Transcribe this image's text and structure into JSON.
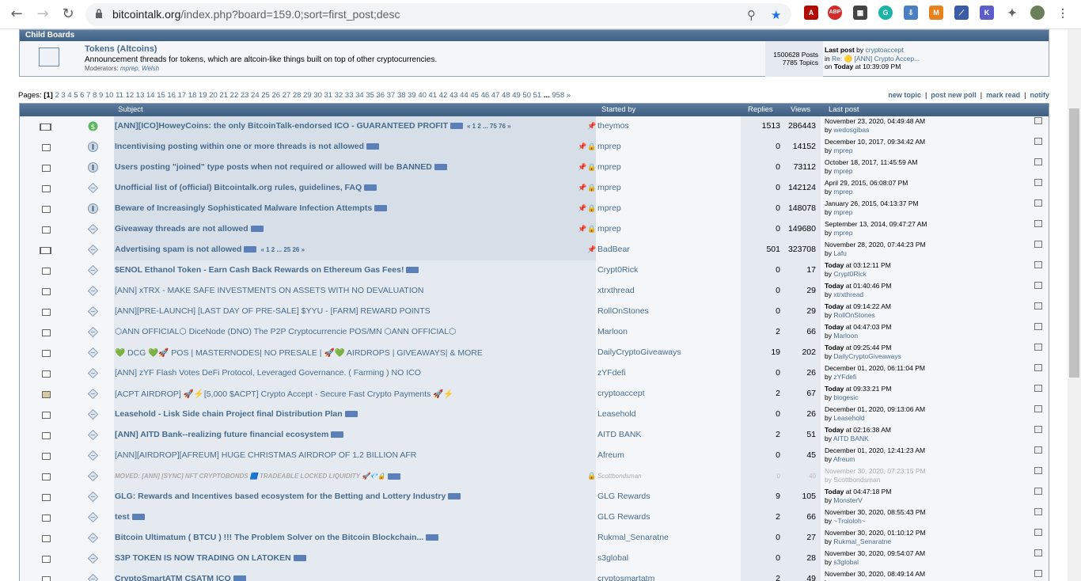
{
  "browser": {
    "url_host": "bitcointalk.org",
    "url_path": "/index.php?board=159.0;sort=first_post;desc"
  },
  "child_boards": {
    "header": "Child Boards",
    "board": {
      "name": "Tokens (Altcoins)",
      "description": "Announcement threads for tokens, which are altcoin-like things built on top of other cryptocurrencies.",
      "moderators_label": "Moderators:",
      "moderators": "mprep, Welsh",
      "posts": "1500628 Posts",
      "topics": "7785 Topics",
      "last_post_label": "Last post",
      "last_post_by": "by",
      "last_post_user": "cryptoaccept",
      "in_label": "in",
      "in_topic": "Re: 🟡 [ANN] Crypto Accep...",
      "on_label": "on",
      "on_today": "Today",
      "on_time": "at 10:39:09 PM"
    }
  },
  "pagination": {
    "label": "Pages:",
    "current": "[1]",
    "pages": "2 3 4 5 6 7 8 9 10 11 12 13 14 15 16 17 18 19 20 21 22 23 24 25 26 27 28 29 30 31 32 33 34 35 36 37 38 39 40 41 42 43 44 45 46 47 48 49 50 51",
    "ellipsis": "...",
    "last": "958",
    "next": "»"
  },
  "actions": [
    "new topic",
    "post new poll",
    "mark read",
    "notify"
  ],
  "table_headers": {
    "subject": "Subject",
    "started_by": "Started by",
    "replies": "Replies",
    "views": "Views",
    "last_post": "Last post"
  },
  "topics": [
    {
      "subject": "[ANN][ICO]HoweyCoins: the only BitcoinTalk-endorsed ICO - GUARANTEED PROFIT",
      "pages": "« 1 2 ... 75 76 »",
      "starter": "theymos",
      "replies": "1513",
      "views": "286443",
      "last_date": "November 23, 2020, 04:49:48 AM",
      "last_by": "by",
      "last_user": "wedosgibas"
    },
    {
      "subject": "Incentivising posting within one or more threads is not allowed",
      "pages": "",
      "starter": "mprep",
      "replies": "0",
      "views": "14152",
      "last_date": "December 10, 2017, 09:34:42 AM",
      "last_by": "by",
      "last_user": "mprep"
    },
    {
      "subject": "Users posting \"joined\" type posts when not required or allowed will be BANNED",
      "pages": "",
      "starter": "mprep",
      "replies": "0",
      "views": "73112",
      "last_date": "October 18, 2017, 11:45:59 AM",
      "last_by": "by",
      "last_user": "mprep"
    },
    {
      "subject": "Unofficial list of (official) Bitcointalk.org rules, guidelines, FAQ",
      "pages": "",
      "starter": "mprep",
      "replies": "0",
      "views": "142124",
      "last_date": "April 29, 2015, 06:08:07 PM",
      "last_by": "by",
      "last_user": "mprep"
    },
    {
      "subject": "Beware of Increasingly Sophisticated Malware Infection Attempts",
      "pages": "",
      "starter": "mprep",
      "replies": "0",
      "views": "148078",
      "last_date": "January 26, 2015, 04:13:37 PM",
      "last_by": "by",
      "last_user": "mprep"
    },
    {
      "subject": "Giveaway threads are not allowed",
      "pages": "",
      "starter": "mprep",
      "replies": "0",
      "views": "149680",
      "last_date": "September 13, 2014, 09:47:27 AM",
      "last_by": "by",
      "last_user": "mprep"
    },
    {
      "subject": "Advertising spam is not allowed",
      "pages": "« 1 2 ... 25 26 »",
      "starter": "BadBear",
      "replies": "501",
      "views": "323708",
      "last_date": "November 28, 2020, 07:44:23 PM",
      "last_by": "by",
      "last_user": "Lafu"
    },
    {
      "subject": "$ENOL Ethanol Token - Earn Cash Back Rewards on Ethereum Gas Fees!",
      "pages": "",
      "starter": "Crypt0Rick",
      "replies": "0",
      "views": "17",
      "last_date": "at 03:12:11 PM",
      "last_today": "Today",
      "last_by": "by",
      "last_user": "Crypt0Rick"
    },
    {
      "subject": "[ANN] xTRX - MAKE SAFE INVESTMENTS ON ASSETS WITH NO DEVALUATION",
      "pages": "",
      "starter": "xtrxthread",
      "replies": "0",
      "views": "29",
      "last_date": "at 01:40:46 PM",
      "last_today": "Today",
      "last_by": "by",
      "last_user": "xtrxthread"
    },
    {
      "subject": "[ANN][PRE-LAUNCH] [LAST DAY OF PRE-SALE] $YYU - [FARM] REWARD POINTS",
      "pages": "",
      "starter": "RollOnStones",
      "replies": "0",
      "views": "29",
      "last_date": "at 09:14:22 AM",
      "last_today": "Today",
      "last_by": "by",
      "last_user": "RollOnStones"
    },
    {
      "subject": "⬡ANN OFFICIAL⬡ DiceNode (DNO) The P2P Cryptocurrencie POS/MN ⬡ANN OFFICIAL⬡",
      "pages": "",
      "starter": "Marloon",
      "replies": "2",
      "views": "66",
      "last_date": "at 04:47:03 PM",
      "last_today": "Today",
      "last_by": "by",
      "last_user": "Marloon"
    },
    {
      "subject": "💚 DCG 💚🚀 POS | MASTERNODES| NO PRESALE | 🚀💚 AIRDROPS | GIVEAWAYS| & MORE",
      "pages": "",
      "starter": "DailyCryptoGiveaways",
      "replies": "19",
      "views": "202",
      "last_date": "at 09:25:44 PM",
      "last_today": "Today",
      "last_by": "by",
      "last_user": "DailyCryptoGiveaways"
    },
    {
      "subject": "[ANN] zYF Flash Votes DeFi Protocol, Leveraged Governance. ( Farming ) NO ICO",
      "pages": "",
      "starter": "zYFdefi",
      "replies": "0",
      "views": "26",
      "last_date": "December 01, 2020, 06:11:04 PM",
      "last_by": "by",
      "last_user": "zYFdefi"
    },
    {
      "subject": "[ACPT AIRDROP] 🚀⚡[5,000 $ACPT] Crypto Accept - Secure Fast Crypto Payments 🚀⚡",
      "pages": "",
      "starter": "cryptoaccept",
      "replies": "2",
      "views": "67",
      "last_date": "at 09:33:21 PM",
      "last_today": "Today",
      "last_by": "by",
      "last_user": "biogesic"
    },
    {
      "subject": "Leasehold - Lisk Side chain Project final Distribution Plan",
      "pages": "",
      "starter": "Leasehold",
      "replies": "0",
      "views": "26",
      "last_date": "December 01, 2020, 09:13:06 AM",
      "last_by": "by",
      "last_user": "Leasehold"
    },
    {
      "subject": "[ANN] AITD Bank--realizing future financial ecosystem",
      "pages": "",
      "starter": "AITD BANK",
      "replies": "2",
      "views": "51",
      "last_date": "at 02:16:38 AM",
      "last_today": "Today",
      "last_by": "by",
      "last_user": "AITD BANK"
    },
    {
      "subject": "[ANN][AIRDROP][AFREUM] HUGE CHRISTMAS AIRDROP OF 1.2 BILLION AFR",
      "pages": "",
      "starter": "Afreum",
      "replies": "0",
      "views": "45",
      "last_date": "December 01, 2020, 12:41:23 AM",
      "last_by": "by",
      "last_user": "Afreum"
    },
    {
      "subject": "MOVED: [ANN] [SYNC] NFT CRYPTOBONDS 🟦 TRADEABLE LOCKED LIQUIDITY 🚀💎🔒",
      "pages": "",
      "starter": "Scottbondsman",
      "replies": "0",
      "views": "40",
      "last_date": "November 30, 2020, 07:23:15 PM",
      "last_by": "by",
      "last_user": "Scottbondsman"
    },
    {
      "subject": "GLG: Rewards and Incentives based ecosystem for the Betting and Lottery Industry",
      "pages": "",
      "starter": "GLG Rewards",
      "replies": "9",
      "views": "105",
      "last_date": "at 04:47:18 PM",
      "last_today": "Today",
      "last_by": "by",
      "last_user": "MonsterV"
    },
    {
      "subject": "test",
      "pages": "",
      "starter": "GLG Rewards",
      "replies": "2",
      "views": "66",
      "last_date": "November 30, 2020, 08:55:43 PM",
      "last_by": "by",
      "last_user": "~Trololoh~"
    },
    {
      "subject": "Bitcoin Ultimatum ( BTCU ) !!! The Problem Solver on the Bitcoin Blockchain...",
      "pages": "",
      "starter": "Rukmal_Senaratne",
      "replies": "0",
      "views": "27",
      "last_date": "November 30, 2020, 01:10:12 PM",
      "last_by": "by",
      "last_user": "Rukmal_Senaratne"
    },
    {
      "subject": "S3P TOKEN IS NOW TRADING ON LATOKEN",
      "pages": "",
      "starter": "s3global",
      "replies": "0",
      "views": "28",
      "last_date": "November 30, 2020, 09:54:07 AM",
      "last_by": "by",
      "last_user": "s3global"
    },
    {
      "subject": "CryptoSmartATM CSATM ICO",
      "pages": "",
      "starter": "cryptosmartatm",
      "replies": "2",
      "views": "49",
      "last_date": "November 30, 2020, 08:49:14 AM",
      "last_by": "by",
      "last_user": ""
    }
  ]
}
